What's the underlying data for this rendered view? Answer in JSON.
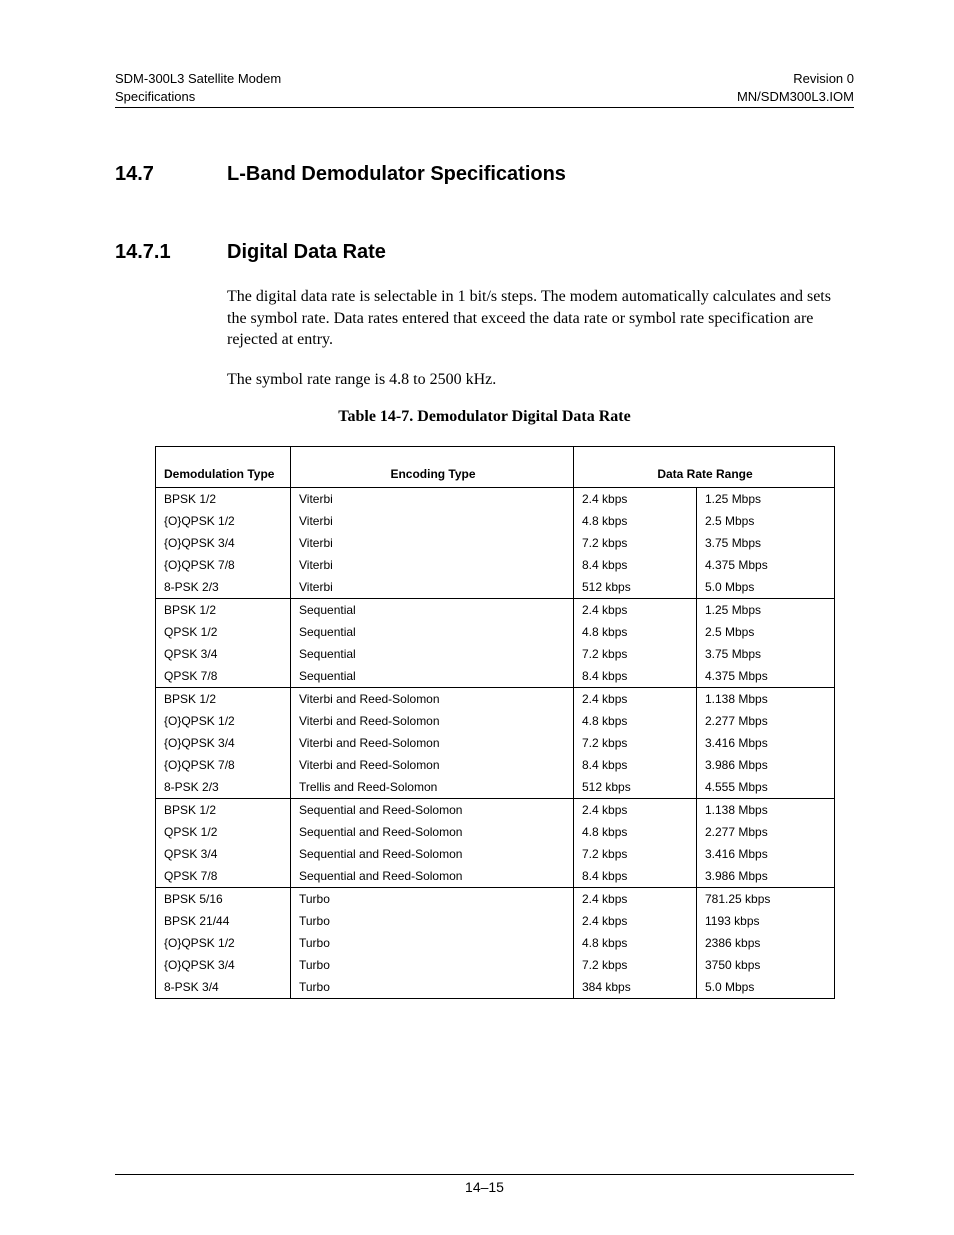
{
  "header": {
    "left1": "SDM-300L3 Satellite Modem",
    "left2": "Specifications",
    "right1": "Revision 0",
    "right2": "MN/SDM300L3.IOM"
  },
  "section": {
    "num": "14.7",
    "title": "L-Band Demodulator Specifications"
  },
  "subsection": {
    "num": "14.7.1",
    "title": "Digital Data Rate"
  },
  "para1": "The digital data rate is selectable in 1 bit/s steps. The modem automatically calculates and sets the symbol rate. Data rates entered that exceed the data rate or symbol rate specification are rejected at entry.",
  "para2": "The symbol rate range is 4.8 to 2500 kHz.",
  "tableCaption": "Table 14-7.  Demodulator Digital Data Rate",
  "columns": {
    "c1": "Demodulation Type",
    "c2": "Encoding Type",
    "c34": "Data Rate Range"
  },
  "rows": [
    {
      "grp": true,
      "c1": "BPSK 1/2",
      "c2": "Viterbi",
      "c3": "2.4 kbps",
      "c4": "1.25 Mbps"
    },
    {
      "c1": "{O}QPSK 1/2",
      "c2": "Viterbi",
      "c3": "4.8 kbps",
      "c4": "2.5 Mbps"
    },
    {
      "c1": "{O}QPSK 3/4",
      "c2": "Viterbi",
      "c3": "7.2 kbps",
      "c4": "3.75 Mbps"
    },
    {
      "c1": "{O}QPSK 7/8",
      "c2": "Viterbi",
      "c3": "8.4 kbps",
      "c4": "4.375 Mbps"
    },
    {
      "c1": "8-PSK 2/3",
      "c2": "Viterbi",
      "c3": "512 kbps",
      "c4": "5.0 Mbps"
    },
    {
      "grp": true,
      "c1": "BPSK 1/2",
      "c2": "Sequential",
      "c3": "2.4 kbps",
      "c4": "1.25 Mbps"
    },
    {
      "c1": "QPSK 1/2",
      "c2": "Sequential",
      "c3": "4.8 kbps",
      "c4": "2.5 Mbps"
    },
    {
      "c1": "QPSK 3/4",
      "c2": "Sequential",
      "c3": "7.2 kbps",
      "c4": "3.75 Mbps"
    },
    {
      "c1": "QPSK 7/8",
      "c2": "Sequential",
      "c3": "8.4 kbps",
      "c4": "4.375 Mbps"
    },
    {
      "grp": true,
      "c1": "BPSK 1/2",
      "c2": "Viterbi and Reed-Solomon",
      "c3": "2.4 kbps",
      "c4": "1.138 Mbps"
    },
    {
      "c1": "{O}QPSK 1/2",
      "c2": "Viterbi and Reed-Solomon",
      "c3": "4.8 kbps",
      "c4": "2.277 Mbps"
    },
    {
      "c1": "{O}QPSK 3/4",
      "c2": "Viterbi and Reed-Solomon",
      "c3": "7.2 kbps",
      "c4": "3.416 Mbps"
    },
    {
      "c1": "{O}QPSK 7/8",
      "c2": "Viterbi and Reed-Solomon",
      "c3": "8.4 kbps",
      "c4": "3.986 Mbps"
    },
    {
      "c1": "8-PSK 2/3",
      "c2": "Trellis and Reed-Solomon",
      "c3": "512 kbps",
      "c4": "4.555 Mbps"
    },
    {
      "grp": true,
      "c1": "BPSK 1/2",
      "c2": "Sequential and Reed-Solomon",
      "c3": "2.4 kbps",
      "c4": "1.138 Mbps"
    },
    {
      "c1": "QPSK 1/2",
      "c2": "Sequential and Reed-Solomon",
      "c3": "4.8 kbps",
      "c4": "2.277 Mbps"
    },
    {
      "c1": "QPSK 3/4",
      "c2": "Sequential and Reed-Solomon",
      "c3": "7.2 kbps",
      "c4": "3.416 Mbps"
    },
    {
      "c1": "QPSK 7/8",
      "c2": "Sequential and Reed-Solomon",
      "c3": "8.4 kbps",
      "c4": "3.986 Mbps"
    },
    {
      "grp": true,
      "c1": "BPSK 5/16",
      "c2": "Turbo",
      "c3": "2.4 kbps",
      "c4": "781.25 kbps"
    },
    {
      "c1": "BPSK 21/44",
      "c2": "Turbo",
      "c3": "2.4 kbps",
      "c4": "1193 kbps"
    },
    {
      "c1": "{O}QPSK 1/2",
      "c2": "Turbo",
      "c3": "4.8 kbps",
      "c4": "2386 kbps"
    },
    {
      "c1": "{O}QPSK 3/4",
      "c2": "Turbo",
      "c3": "7.2 kbps",
      "c4": "3750 kbps"
    },
    {
      "last": true,
      "c1": "8-PSK 3/4",
      "c2": "Turbo",
      "c3": "384 kbps",
      "c4": "5.0 Mbps"
    }
  ],
  "pageNumber": "14–15"
}
